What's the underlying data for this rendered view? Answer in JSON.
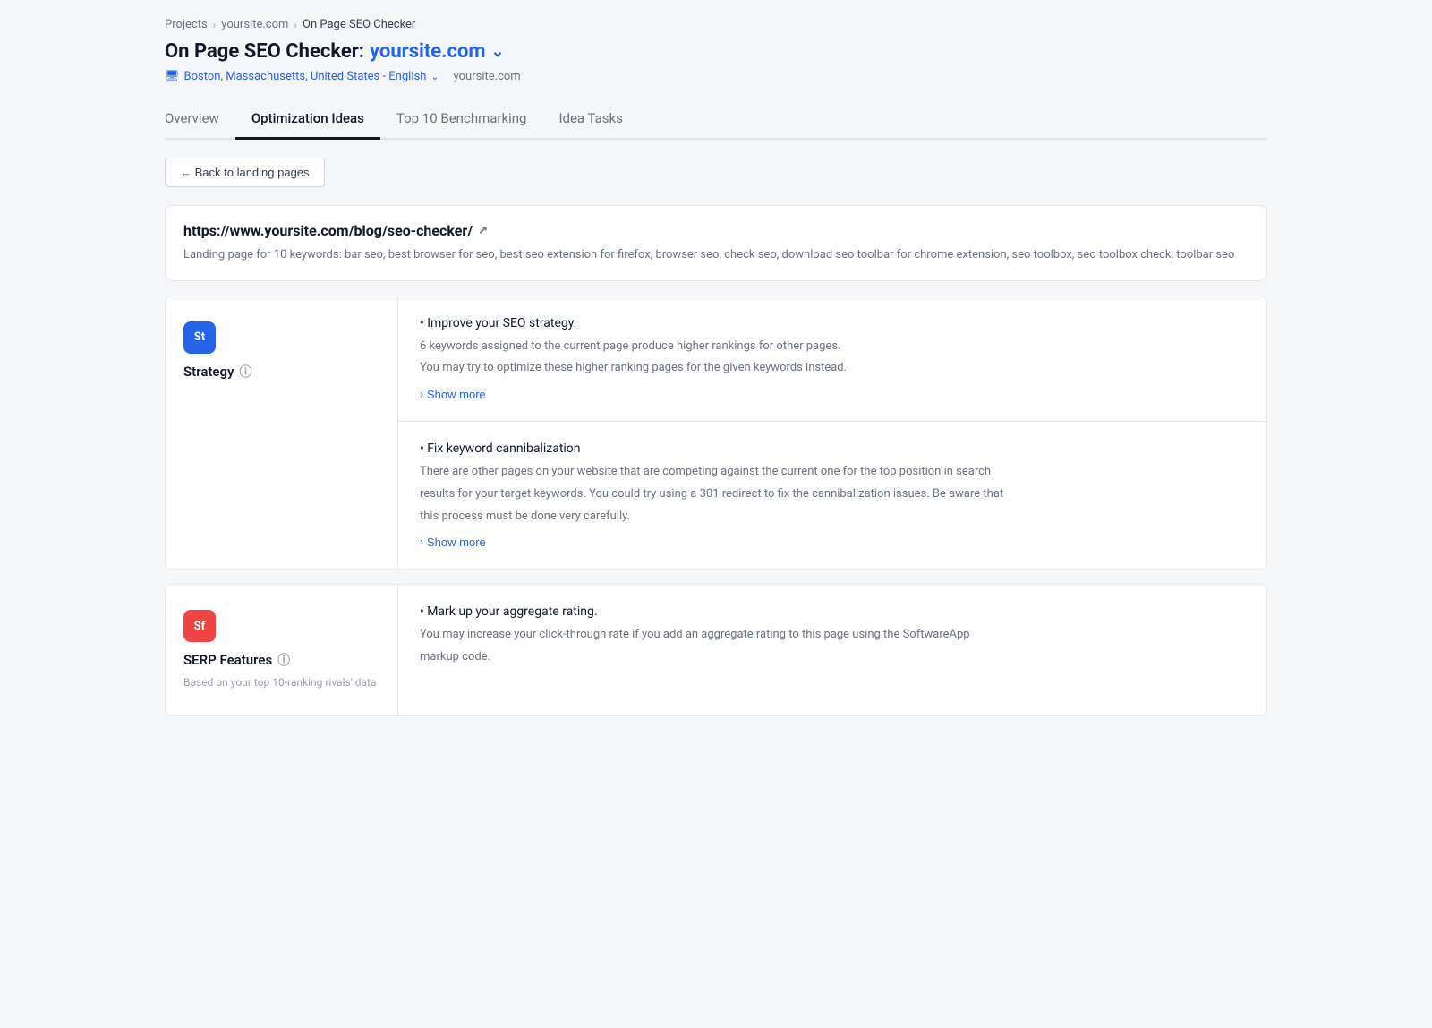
{
  "breadcrumb": {
    "items": [
      {
        "label": "Projects",
        "active": false
      },
      {
        "label": "yoursite.com",
        "active": false
      },
      {
        "label": "On Page SEO Checker",
        "active": true
      }
    ]
  },
  "page_title": {
    "prefix": "On Page SEO Checker:",
    "site": "yoursite.com",
    "chevron": "∨"
  },
  "location": {
    "icon": "🖥",
    "text": "Boston, Massachusetts, United States - English",
    "domain": "yoursite.com"
  },
  "tabs": [
    {
      "label": "Overview",
      "active": false
    },
    {
      "label": "Optimization Ideas",
      "active": true
    },
    {
      "label": "Top 10 Benchmarking",
      "active": false
    },
    {
      "label": "Idea Tasks",
      "active": false
    }
  ],
  "back_button": "← Back to landing pages",
  "url_card": {
    "url": "https://www.yoursite.com/blog/seo-checker/",
    "keywords_label": "Landing page for 10 keywords: bar seo, best browser for seo, best seo extension for firefox, browser seo, check seo, download seo toolbar for chrome extension, seo toolbox, seo toolbox check, toolbar seo"
  },
  "sections": [
    {
      "badge": "St",
      "badge_color": "blue",
      "title": "Strategy",
      "show_info": true,
      "subtitle": "",
      "ideas": [
        {
          "bullet": "• Improve your SEO strategy.",
          "description_lines": [
            "6 keywords assigned to the current page produce higher rankings for other pages.",
            "You may try to optimize these higher ranking pages for the given keywords instead."
          ],
          "description_overflow": false,
          "show_more_label": "Show more"
        },
        {
          "bullet": "• Fix keyword cannibalization",
          "description_lines": [
            "There are other pages on your website that are competing against the current one for the top position in search",
            "results for your target keywords. You could try using a 301 redirect to fix the cannibalization issues. Be aware that",
            "this process must be done very carefully."
          ],
          "description_overflow": true,
          "show_more_label": "Show more"
        }
      ]
    },
    {
      "badge": "Sf",
      "badge_color": "red",
      "title": "SERP Features",
      "show_info": true,
      "subtitle": "Based on your top 10-ranking rivals' data",
      "ideas": [
        {
          "bullet": "• Mark up your aggregate rating.",
          "description_lines": [
            "You may increase your click-through rate if you add an aggregate rating to this page using the SoftwareApp",
            "markup code."
          ],
          "description_overflow": true,
          "show_more_label": ""
        }
      ]
    }
  ]
}
